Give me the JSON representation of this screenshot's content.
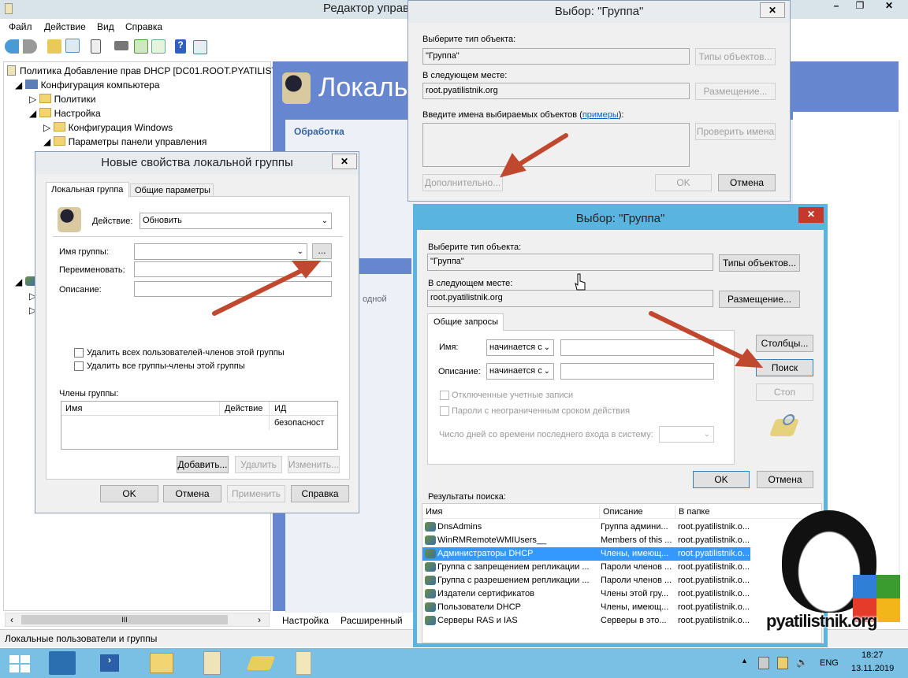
{
  "main_window": {
    "title": "Редактор управ",
    "menu": [
      "Файл",
      "Действие",
      "Вид",
      "Справка"
    ],
    "tree": {
      "root": "Политика Добавление прав DHCP [DC01.ROOT.PYATILIST",
      "items": [
        "Конфигурация компьютера",
        "Политики",
        "Настройка",
        "Конфигурация Windows",
        "Параметры панели управления"
      ]
    },
    "right_header": "Локальны",
    "panel_title": "Обработка",
    "partial_text": "одной",
    "tabs": [
      "Настройка",
      "Расширенный"
    ],
    "status": "Локальные пользователи и группы",
    "scroll_grip": "III"
  },
  "props_dialog": {
    "title": "Новые свойства локальной группы",
    "tabs": [
      "Локальная группа",
      "Общие параметры"
    ],
    "action_label": "Действие:",
    "action_value": "Обновить",
    "group_name_label": "Имя группы:",
    "group_name_value": "",
    "browse_label": "...",
    "rename_label": "Переименовать:",
    "description_label": "Описание:",
    "delete_users": "Удалить всех пользователей-членов этой группы",
    "delete_groups": "Удалить все группы-члены этой группы",
    "members_label": "Члены группы:",
    "columns": [
      "Имя",
      "Действие",
      "ИД безопасност"
    ],
    "add": "Добавить...",
    "remove": "Удалить",
    "edit": "Изменить...",
    "ok": "OK",
    "cancel": "Отмена",
    "apply": "Применить",
    "help": "Справка"
  },
  "select_dialog_small": {
    "title": "Выбор: \"Группа\"",
    "type_label": "Выберите тип объекта:",
    "type_value": "\"Группа\"",
    "types_btn": "Типы объектов...",
    "location_label": "В следующем месте:",
    "location_value": "root.pyatilistnik.org",
    "location_btn": "Размещение...",
    "names_label": "Введите имена выбираемых объектов (",
    "examples_link": "примеры",
    "names_label_end": "):",
    "check_btn": "Проверить имена",
    "advanced_btn": "Дополнительно...",
    "ok": "OK",
    "cancel": "Отмена"
  },
  "select_dialog_adv": {
    "title": "Выбор: \"Группа\"",
    "type_label": "Выберите тип объекта:",
    "type_value": "\"Группа\"",
    "types_btn": "Типы объектов...",
    "location_label": "В следующем месте:",
    "location_value": "root.pyatilistnik.org",
    "location_btn": "Размещение...",
    "query_tab": "Общие запросы",
    "name_label": "Имя:",
    "name_mode": "начинается с",
    "desc_label": "Описание:",
    "desc_mode": "начинается с",
    "disabled_accounts": "Отключенные учетные записи",
    "no_expire": "Пароли с неограниченным сроком действия",
    "days_label": "Число дней со времени последнего входа в систему:",
    "columns_btn": "Столбцы...",
    "search_btn": "Поиск",
    "stop_btn": "Стоп",
    "ok": "OK",
    "cancel": "Отмена",
    "results_label": "Результаты поиска:",
    "result_columns": [
      "Имя",
      "Описание",
      "В папке"
    ],
    "results": [
      {
        "name": "DnsAdmins",
        "desc": "Группа админи...",
        "folder": "root.pyatilistnik.o..."
      },
      {
        "name": "WinRMRemoteWMIUsers__",
        "desc": "Members of this ...",
        "folder": "root.pyatilistnik.o..."
      },
      {
        "name": "Администраторы DHCP",
        "desc": "Члены, имеющ...",
        "folder": "root.pyatilistnik.o...",
        "selected": true
      },
      {
        "name": "Группа с запрещением репликации ...",
        "desc": "Пароли членов ...",
        "folder": "root.pyatilistnik.o..."
      },
      {
        "name": "Группа с разрешением репликации ...",
        "desc": "Пароли членов ...",
        "folder": "root.pyatilistnik.o..."
      },
      {
        "name": "Издатели сертификатов",
        "desc": "Члены этой гру...",
        "folder": "root.pyatilistnik.o..."
      },
      {
        "name": "Пользователи DHCP",
        "desc": "Члены, имеющ...",
        "folder": "root.pyatilistnik.o..."
      },
      {
        "name": "Серверы RAS и IAS",
        "desc": "Серверы в это...",
        "folder": "root.pyatilistnik.o..."
      }
    ]
  },
  "watermark": "pyatilistnik.org",
  "taskbar": {
    "lang": "ENG",
    "time": "18:27",
    "date": "13.11.2019"
  },
  "colors": {
    "arrow": "#c0482e",
    "selection": "#3399ff",
    "panel_blue": "#6686cf",
    "taskbar": "#79c0e4"
  }
}
